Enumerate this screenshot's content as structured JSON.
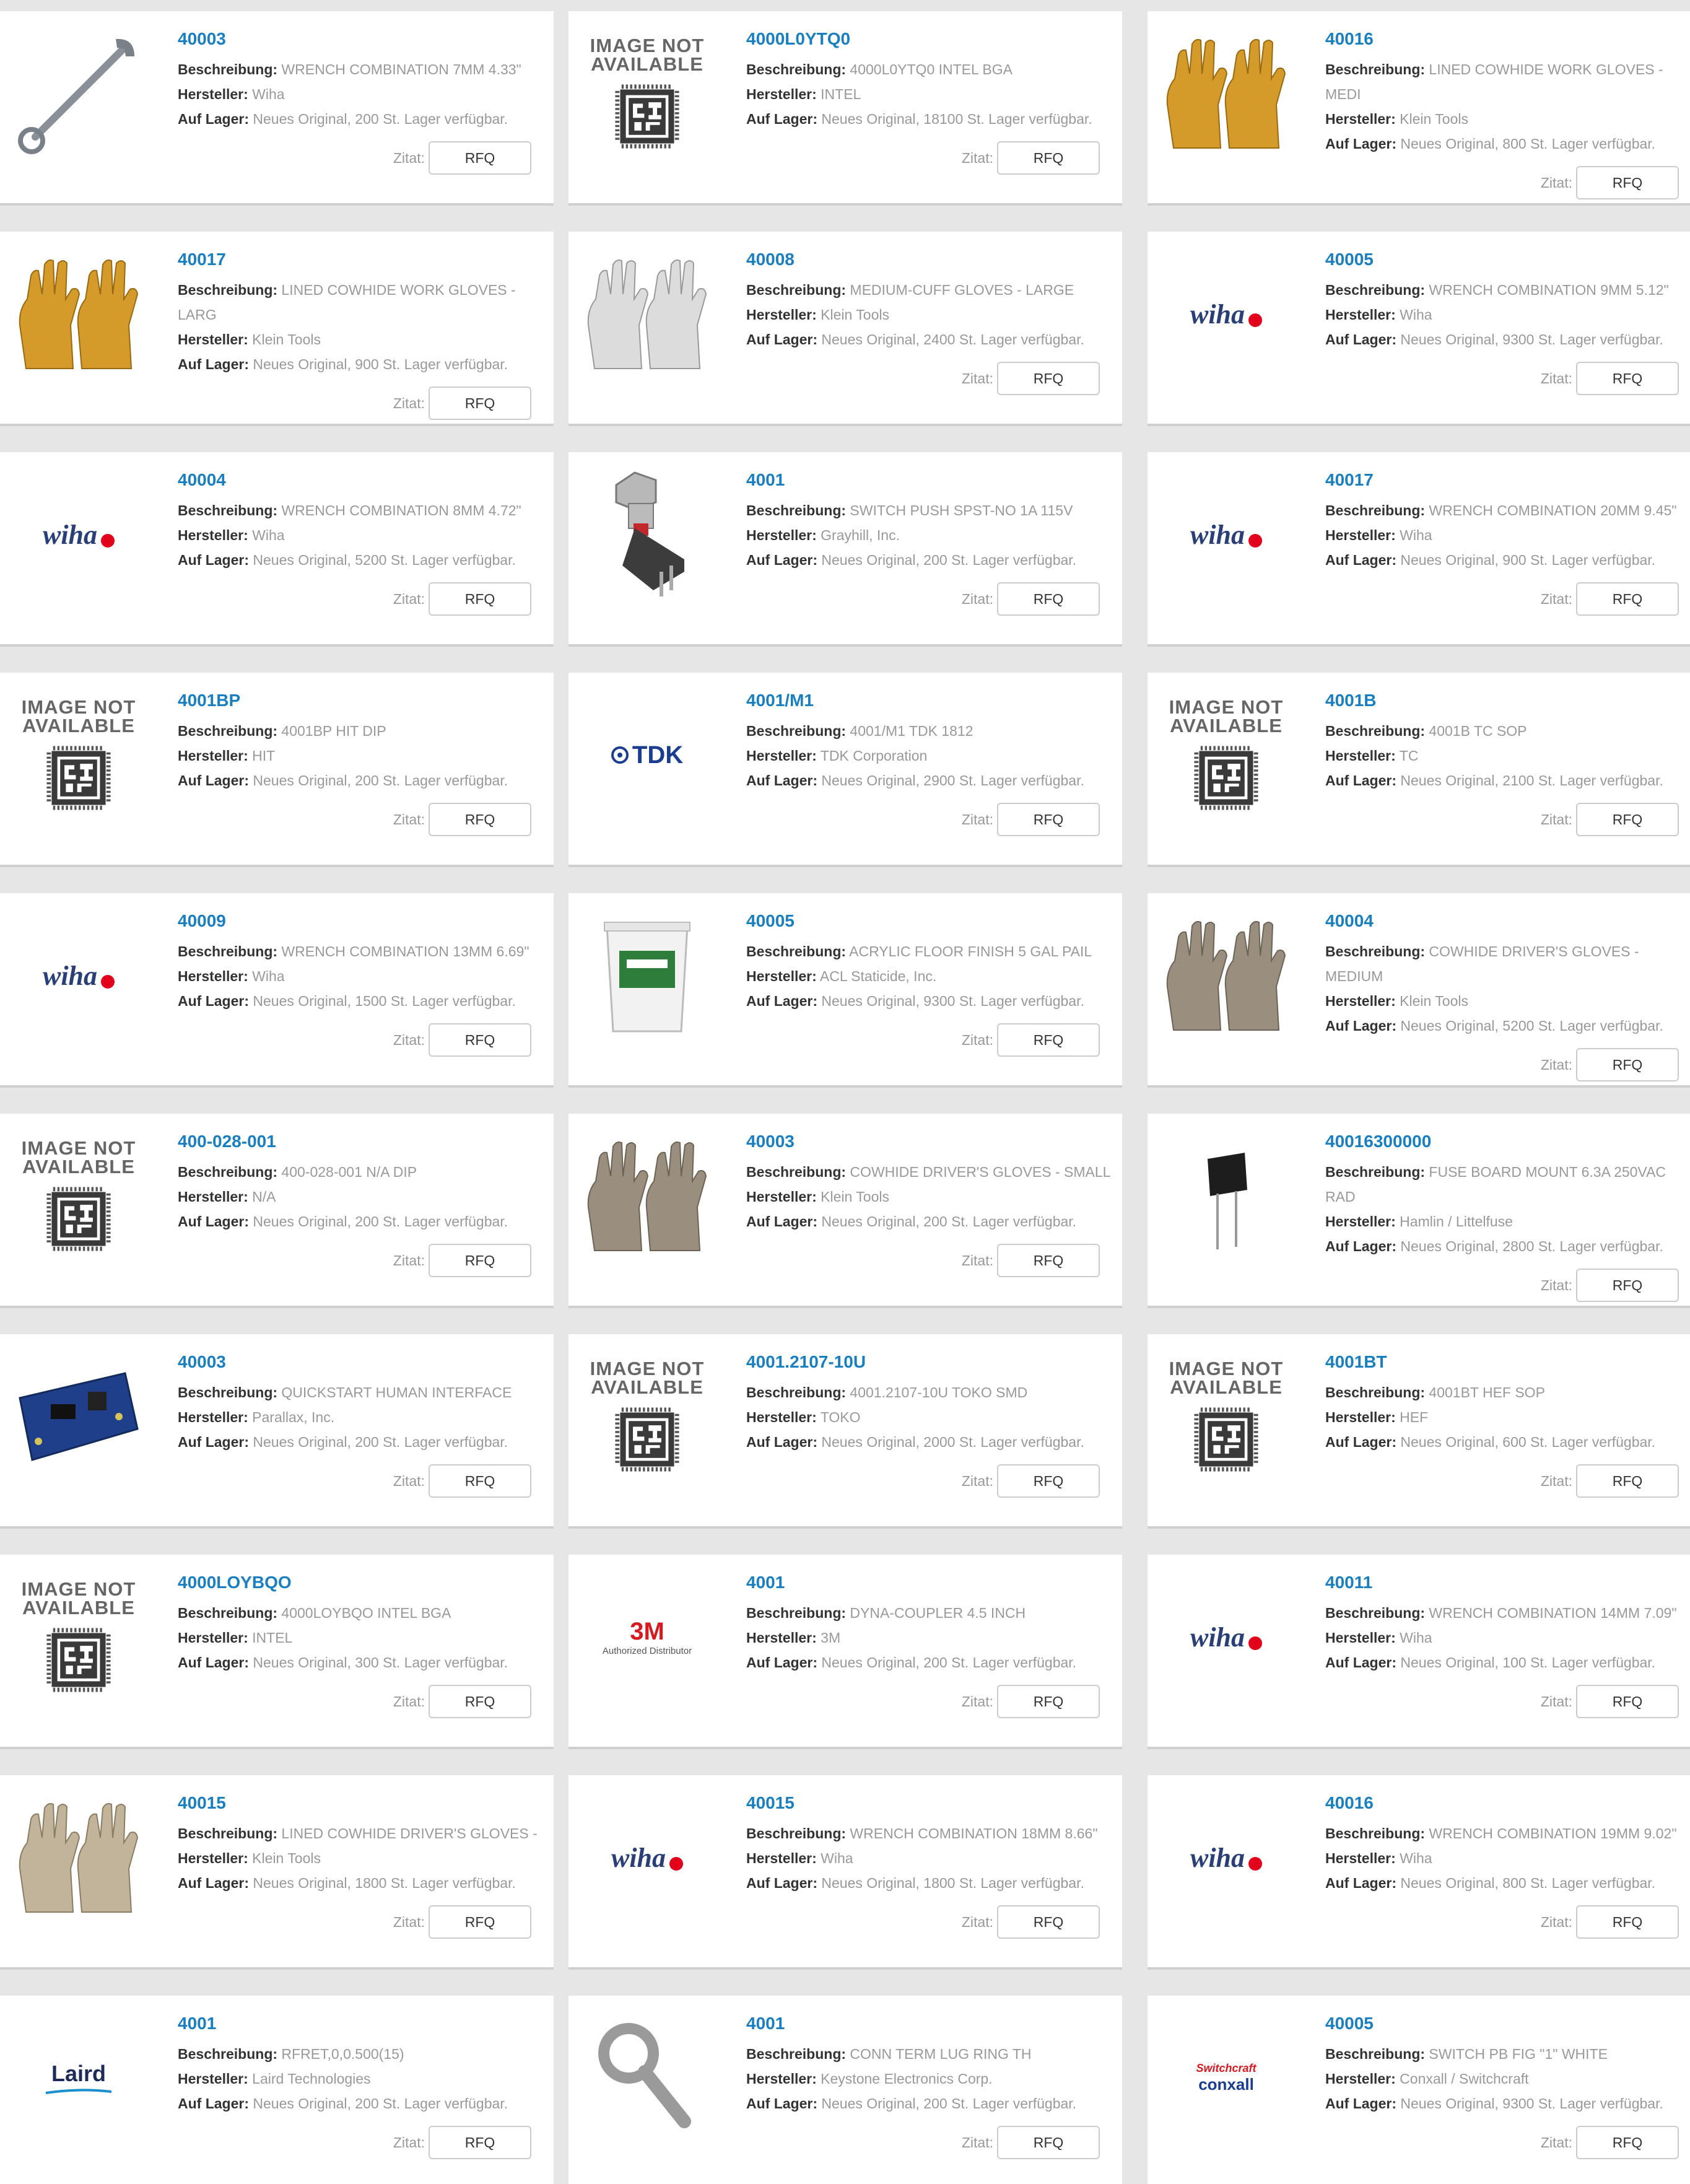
{
  "labels": {
    "desc": "Beschreibung:",
    "mfr": "Hersteller:",
    "stock": "Auf Lager:",
    "quote": "Zitat:",
    "rfq": "RFQ"
  },
  "image_not_available": [
    "IMAGE NOT",
    "AVAILABLE"
  ],
  "brand_text": {
    "wiha": "wiha",
    "tdk": "TDK",
    "m3": "3M",
    "m3_sub": "Authorized Distributor",
    "laird": "Laird",
    "switchcraft": "Switchcraft",
    "conxall": "conxall"
  },
  "products": [
    {
      "part": "40003",
      "desc": "WRENCH COMBINATION 7MM 4.33\"",
      "mfr": "Wiha",
      "stock": "Neues Original, 200 St. Lager verfügbar.",
      "image": "wrench"
    },
    {
      "part": "4000L0YTQ0",
      "desc": "4000L0YTQ0 INTEL BGA",
      "mfr": "INTEL",
      "stock": "Neues Original, 18100 St. Lager verfügbar.",
      "image": "not-available"
    },
    {
      "part": "40016",
      "desc": "LINED COWHIDE WORK GLOVES - MEDI",
      "mfr": "Klein Tools",
      "stock": "Neues Original, 800 St. Lager verfügbar.",
      "image": "glove-yellow"
    },
    {
      "part": "40017",
      "desc": "LINED COWHIDE WORK GLOVES - LARG",
      "mfr": "Klein Tools",
      "stock": "Neues Original, 900 St. Lager verfügbar.",
      "image": "glove-yellow"
    },
    {
      "part": "40008",
      "desc": "MEDIUM-CUFF GLOVES - LARGE",
      "mfr": "Klein Tools",
      "stock": "Neues Original, 2400 St. Lager verfügbar.",
      "image": "glove-white"
    },
    {
      "part": "40005",
      "desc": "WRENCH COMBINATION 9MM 5.12\"",
      "mfr": "Wiha",
      "stock": "Neues Original, 9300 St. Lager verfügbar.",
      "image": "wiha"
    },
    {
      "part": "40004",
      "desc": "WRENCH COMBINATION 8MM 4.72\"",
      "mfr": "Wiha",
      "stock": "Neues Original, 5200 St. Lager verfügbar.",
      "image": "wiha"
    },
    {
      "part": "4001",
      "desc": "SWITCH PUSH SPST-NO 1A 115V",
      "mfr": "Grayhill, Inc.",
      "stock": "Neues Original, 200 St. Lager verfügbar.",
      "image": "switch"
    },
    {
      "part": "40017",
      "desc": "WRENCH COMBINATION 20MM 9.45\"",
      "mfr": "Wiha",
      "stock": "Neues Original, 900 St. Lager verfügbar.",
      "image": "wiha"
    },
    {
      "part": "4001BP",
      "desc": "4001BP HIT DIP",
      "mfr": "HIT",
      "stock": "Neues Original, 200 St. Lager verfügbar.",
      "image": "not-available"
    },
    {
      "part": "4001/M1",
      "desc": "4001/M1 TDK 1812",
      "mfr": "TDK Corporation",
      "stock": "Neues Original, 2900 St. Lager verfügbar.",
      "image": "tdk"
    },
    {
      "part": "4001B",
      "desc": "4001B TC SOP",
      "mfr": "TC",
      "stock": "Neues Original, 2100 St. Lager verfügbar.",
      "image": "not-available"
    },
    {
      "part": "40009",
      "desc": "WRENCH COMBINATION 13MM 6.69\"",
      "mfr": "Wiha",
      "stock": "Neues Original, 1500 St. Lager verfügbar.",
      "image": "wiha"
    },
    {
      "part": "40005",
      "desc": "ACRYLIC FLOOR FINISH 5 GAL PAIL",
      "mfr": "ACL Staticide, Inc.",
      "stock": "Neues Original, 9300 St. Lager verfügbar.",
      "image": "pail"
    },
    {
      "part": "40004",
      "desc": "COWHIDE DRIVER'S GLOVES - MEDIUM",
      "mfr": "Klein Tools",
      "stock": "Neues Original, 5200 St. Lager verfügbar.",
      "image": "glove-grey"
    },
    {
      "part": "400-028-001",
      "desc": "400-028-001 N/A DIP",
      "mfr": "N/A",
      "stock": "Neues Original, 200 St. Lager verfügbar.",
      "image": "not-available"
    },
    {
      "part": "40003",
      "desc": "COWHIDE DRIVER'S GLOVES - SMALL",
      "mfr": "Klein Tools",
      "stock": "Neues Original, 200 St. Lager verfügbar.",
      "image": "glove-grey"
    },
    {
      "part": "40016300000",
      "desc": "FUSE BOARD MOUNT 6.3A 250VAC RAD",
      "mfr": "Hamlin / Littelfuse",
      "stock": "Neues Original, 2800 St. Lager verfügbar.",
      "image": "fuse"
    },
    {
      "part": "40003",
      "desc": "QUICKSTART HUMAN INTERFACE",
      "mfr": "Parallax, Inc.",
      "stock": "Neues Original, 200 St. Lager verfügbar.",
      "image": "board"
    },
    {
      "part": "4001.2107-10U",
      "desc": "4001.2107-10U TOKO SMD",
      "mfr": "TOKO",
      "stock": "Neues Original, 2000 St. Lager verfügbar.",
      "image": "not-available"
    },
    {
      "part": "4001BT",
      "desc": "4001BT HEF SOP",
      "mfr": "HEF",
      "stock": "Neues Original, 600 St. Lager verfügbar.",
      "image": "not-available"
    },
    {
      "part": "4000LOYBQO",
      "desc": "4000LOYBQO INTEL BGA",
      "mfr": "INTEL",
      "stock": "Neues Original, 300 St. Lager verfügbar.",
      "image": "not-available"
    },
    {
      "part": "4001",
      "desc": "DYNA-COUPLER 4.5 INCH",
      "mfr": "3M",
      "stock": "Neues Original, 200 St. Lager verfügbar.",
      "image": "3m"
    },
    {
      "part": "40011",
      "desc": "WRENCH COMBINATION 14MM 7.09\"",
      "mfr": "Wiha",
      "stock": "Neues Original, 100 St. Lager verfügbar.",
      "image": "wiha"
    },
    {
      "part": "40015",
      "desc": "LINED COWHIDE DRIVER'S GLOVES -",
      "mfr": "Klein Tools",
      "stock": "Neues Original, 1800 St. Lager verfügbar.",
      "image": "glove-beige"
    },
    {
      "part": "40015",
      "desc": "WRENCH COMBINATION 18MM 8.66\"",
      "mfr": "Wiha",
      "stock": "Neues Original, 1800 St. Lager verfügbar.",
      "image": "wiha"
    },
    {
      "part": "40016",
      "desc": "WRENCH COMBINATION 19MM 9.02\"",
      "mfr": "Wiha",
      "stock": "Neues Original, 800 St. Lager verfügbar.",
      "image": "wiha"
    },
    {
      "part": "4001",
      "desc": "RFRET,0,0.500(15)",
      "mfr": "Laird Technologies",
      "stock": "Neues Original, 200 St. Lager verfügbar.",
      "image": "laird"
    },
    {
      "part": "4001",
      "desc": "CONN TERM LUG RING TH",
      "mfr": "Keystone Electronics Corp.",
      "stock": "Neues Original, 200 St. Lager verfügbar.",
      "image": "ring-lug"
    },
    {
      "part": "40005",
      "desc": "SWITCH PB FIG \"1\" WHITE",
      "mfr": "Conxall / Switchcraft",
      "stock": "Neues Original, 9300 St. Lager verfügbar.",
      "image": "switchcraft"
    }
  ]
}
